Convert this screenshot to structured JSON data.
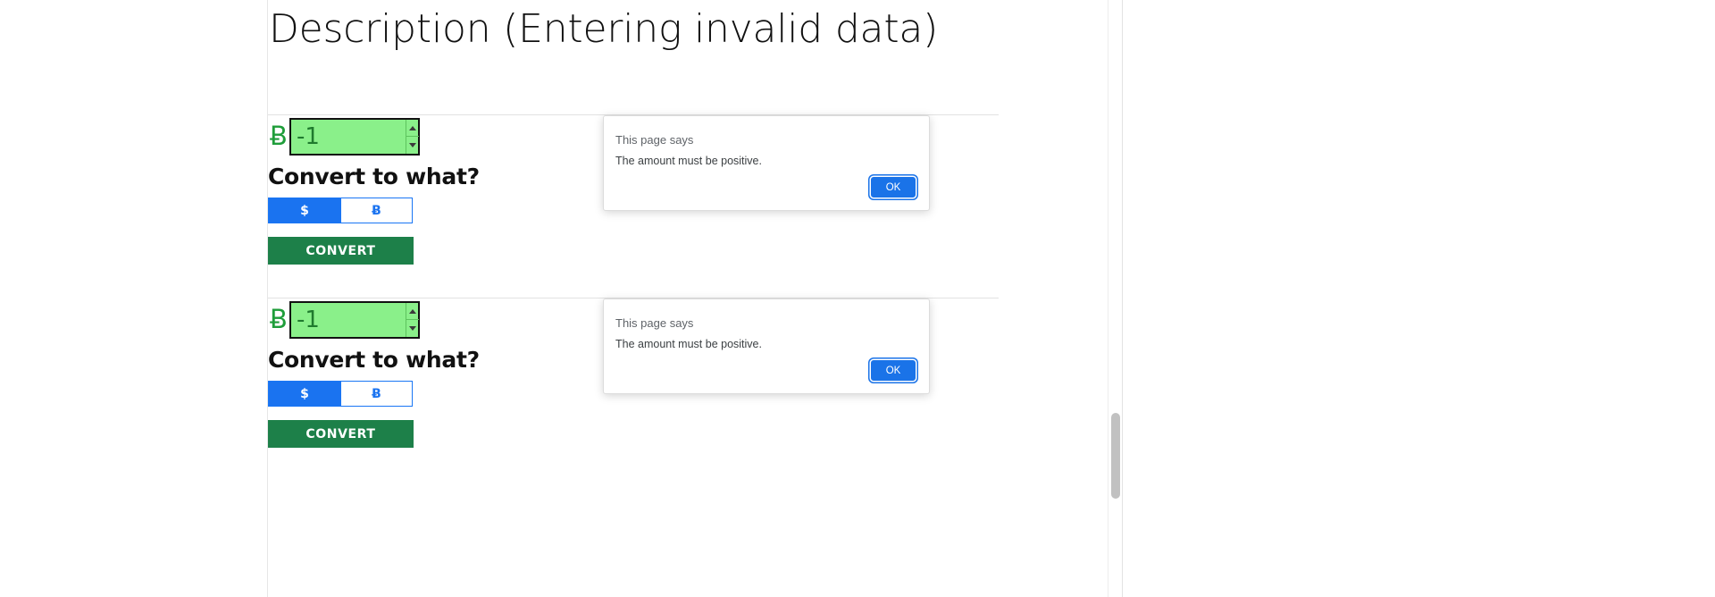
{
  "page": {
    "title": "Description (Entering invalid data)"
  },
  "converters": [
    {
      "currency_symbol": "Ƀ",
      "amount_value": "-1",
      "amount_placeholder": "",
      "heading": "Convert to what?",
      "toggle": {
        "options": [
          {
            "label": "$",
            "active": true
          },
          {
            "label": "Ƀ",
            "active": false
          }
        ]
      },
      "convert_label": "CONVERT"
    },
    {
      "currency_symbol": "Ƀ",
      "amount_value": "-1",
      "amount_placeholder": "",
      "heading": "Convert to what?",
      "toggle": {
        "options": [
          {
            "label": "$",
            "active": true
          },
          {
            "label": "Ƀ",
            "active": false
          }
        ]
      },
      "convert_label": "CONVERT"
    }
  ],
  "dialogs": [
    {
      "title": "This page says",
      "message": "The amount must be positive.",
      "ok_label": "OK"
    },
    {
      "title": "This page says",
      "message": "The amount must be positive.",
      "ok_label": "OK"
    }
  ],
  "colors": {
    "input_fill": "#8af08a",
    "input_text": "#1f7a2e",
    "btc_symbol": "#1f9d3a",
    "toggle_active": "#1a73f0",
    "toggle_border": "#1976f5",
    "convert_button": "#1d8049",
    "dialog_ok": "#1a73e8"
  }
}
